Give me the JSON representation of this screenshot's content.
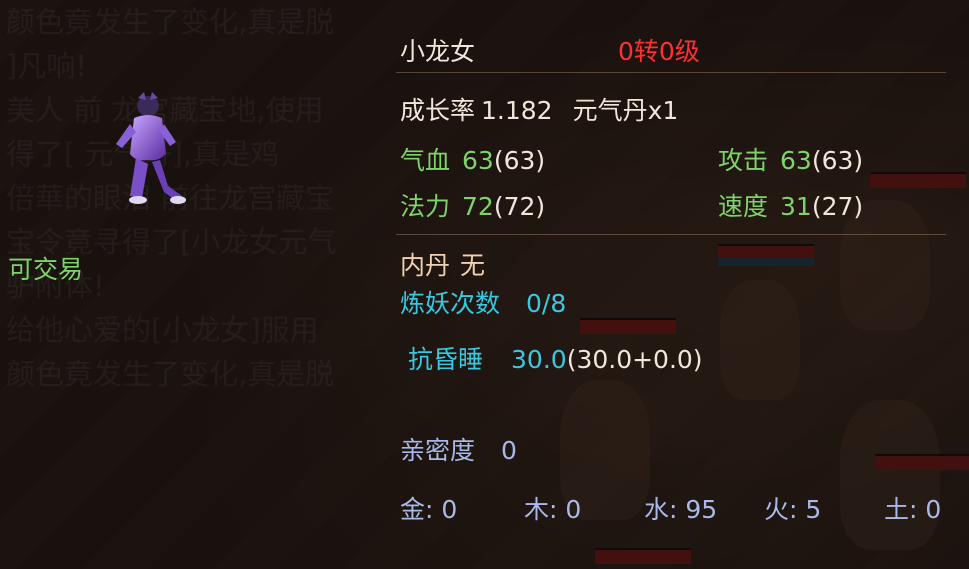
{
  "chat_background": [
    "颜色竟发生了变化,真是脱",
    "]凡响!",
    "美人 前 龙宫藏宝地,使用",
    "得了[ 元气丹],真是鸡",
    "",
    "倍華的眼泪 前往龙宫藏宝",
    "宝令竟寻得了[小龙女元气",
    "驴附体!",
    "",
    "给他心爱的[小龙女]服用",
    "颜色竟发生了变化,真是脱"
  ],
  "pet": {
    "name": "小龙女",
    "level": "0转0级",
    "tradeable": "可交易",
    "growth_label": "成长率",
    "growth_value": "1.182",
    "pill": "元气丹x1"
  },
  "stats": {
    "hp": {
      "label": "气血",
      "value": "63",
      "base": "(63)"
    },
    "attack": {
      "label": "攻击",
      "value": "63",
      "base": "(63)"
    },
    "mp": {
      "label": "法力",
      "value": "72",
      "base": "(72)"
    },
    "speed": {
      "label": "速度",
      "value": "31",
      "base": "(27)"
    }
  },
  "neidan": {
    "label": "内丹",
    "value": "无"
  },
  "refine": {
    "label": "炼妖次数",
    "value": "0/8"
  },
  "resist_sleep": {
    "label": "抗昏睡",
    "value_main": "30.0",
    "value_detail": "(30.0+0.0)"
  },
  "intimacy": {
    "label": "亲密度",
    "value": "0"
  },
  "elements": [
    {
      "label": "金:",
      "value": "0"
    },
    {
      "label": "木:",
      "value": "0"
    },
    {
      "label": "水:",
      "value": "95"
    },
    {
      "label": "火:",
      "value": "5"
    },
    {
      "label": "土:",
      "value": "0"
    }
  ],
  "colors": {
    "name_red": "#ff3030",
    "stat_green": "#7ed36a",
    "cyan": "#38c8e0",
    "lavender": "#a8b8e8"
  }
}
